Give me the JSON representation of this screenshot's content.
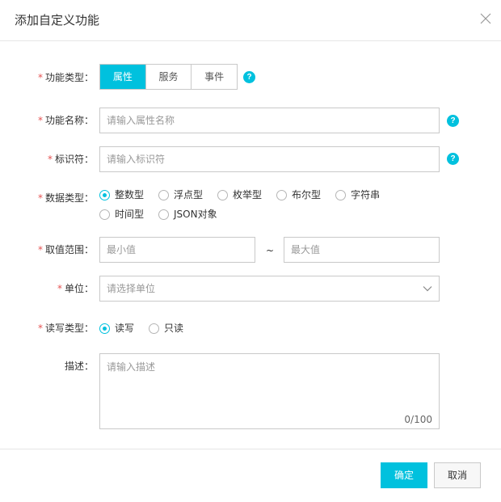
{
  "dialog": {
    "title": "添加自定义功能",
    "close_icon": "close-icon"
  },
  "form": {
    "feature_type": {
      "label": "功能类型：",
      "required": "*",
      "options": [
        "属性",
        "服务",
        "事件"
      ],
      "selected": "属性"
    },
    "feature_name": {
      "label": "功能名称：",
      "required": "*",
      "placeholder": "请输入属性名称",
      "value": ""
    },
    "identifier": {
      "label": "标识符：",
      "required": "*",
      "placeholder": "请输入标识符",
      "value": ""
    },
    "data_type": {
      "label": "数据类型：",
      "required": "*",
      "options": [
        "整数型",
        "浮点型",
        "枚举型",
        "布尔型",
        "字符串",
        "时间型",
        "JSON对象"
      ],
      "selected": "整数型"
    },
    "value_range": {
      "label": "取值范围：",
      "required": "*",
      "min_placeholder": "最小值",
      "max_placeholder": "最大值",
      "separator": "~"
    },
    "unit": {
      "label": "单位：",
      "required": "*",
      "placeholder": "请选择单位"
    },
    "rw_type": {
      "label": "读写类型：",
      "required": "*",
      "options": [
        "读写",
        "只读"
      ],
      "selected": "读写"
    },
    "description": {
      "label": "描述：",
      "placeholder": "请输入描述",
      "counter": "0/100"
    },
    "help_symbol": "?"
  },
  "footer": {
    "confirm_label": "确定",
    "cancel_label": "取消"
  },
  "colors": {
    "accent": "#00c1de",
    "required": "#e55353",
    "border": "#c9c9c9"
  }
}
